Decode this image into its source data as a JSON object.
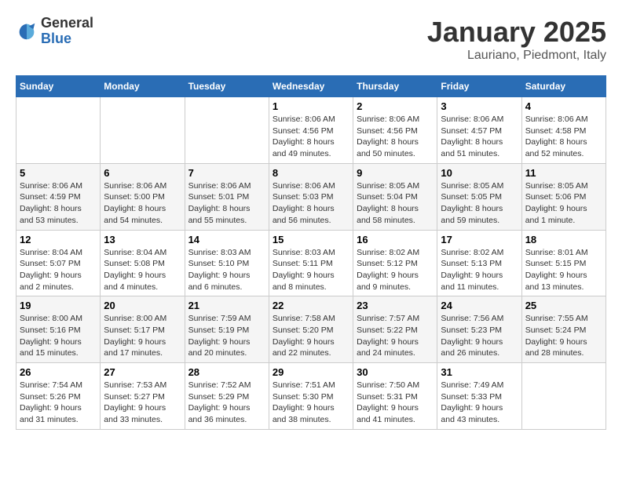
{
  "header": {
    "logo_general": "General",
    "logo_blue": "Blue",
    "month_title": "January 2025",
    "location": "Lauriano, Piedmont, Italy"
  },
  "weekdays": [
    "Sunday",
    "Monday",
    "Tuesday",
    "Wednesday",
    "Thursday",
    "Friday",
    "Saturday"
  ],
  "weeks": [
    [
      {
        "day": "",
        "info": ""
      },
      {
        "day": "",
        "info": ""
      },
      {
        "day": "",
        "info": ""
      },
      {
        "day": "1",
        "info": "Sunrise: 8:06 AM\nSunset: 4:56 PM\nDaylight: 8 hours and 49 minutes."
      },
      {
        "day": "2",
        "info": "Sunrise: 8:06 AM\nSunset: 4:56 PM\nDaylight: 8 hours and 50 minutes."
      },
      {
        "day": "3",
        "info": "Sunrise: 8:06 AM\nSunset: 4:57 PM\nDaylight: 8 hours and 51 minutes."
      },
      {
        "day": "4",
        "info": "Sunrise: 8:06 AM\nSunset: 4:58 PM\nDaylight: 8 hours and 52 minutes."
      }
    ],
    [
      {
        "day": "5",
        "info": "Sunrise: 8:06 AM\nSunset: 4:59 PM\nDaylight: 8 hours and 53 minutes."
      },
      {
        "day": "6",
        "info": "Sunrise: 8:06 AM\nSunset: 5:00 PM\nDaylight: 8 hours and 54 minutes."
      },
      {
        "day": "7",
        "info": "Sunrise: 8:06 AM\nSunset: 5:01 PM\nDaylight: 8 hours and 55 minutes."
      },
      {
        "day": "8",
        "info": "Sunrise: 8:06 AM\nSunset: 5:03 PM\nDaylight: 8 hours and 56 minutes."
      },
      {
        "day": "9",
        "info": "Sunrise: 8:05 AM\nSunset: 5:04 PM\nDaylight: 8 hours and 58 minutes."
      },
      {
        "day": "10",
        "info": "Sunrise: 8:05 AM\nSunset: 5:05 PM\nDaylight: 8 hours and 59 minutes."
      },
      {
        "day": "11",
        "info": "Sunrise: 8:05 AM\nSunset: 5:06 PM\nDaylight: 9 hours and 1 minute."
      }
    ],
    [
      {
        "day": "12",
        "info": "Sunrise: 8:04 AM\nSunset: 5:07 PM\nDaylight: 9 hours and 2 minutes."
      },
      {
        "day": "13",
        "info": "Sunrise: 8:04 AM\nSunset: 5:08 PM\nDaylight: 9 hours and 4 minutes."
      },
      {
        "day": "14",
        "info": "Sunrise: 8:03 AM\nSunset: 5:10 PM\nDaylight: 9 hours and 6 minutes."
      },
      {
        "day": "15",
        "info": "Sunrise: 8:03 AM\nSunset: 5:11 PM\nDaylight: 9 hours and 8 minutes."
      },
      {
        "day": "16",
        "info": "Sunrise: 8:02 AM\nSunset: 5:12 PM\nDaylight: 9 hours and 9 minutes."
      },
      {
        "day": "17",
        "info": "Sunrise: 8:02 AM\nSunset: 5:13 PM\nDaylight: 9 hours and 11 minutes."
      },
      {
        "day": "18",
        "info": "Sunrise: 8:01 AM\nSunset: 5:15 PM\nDaylight: 9 hours and 13 minutes."
      }
    ],
    [
      {
        "day": "19",
        "info": "Sunrise: 8:00 AM\nSunset: 5:16 PM\nDaylight: 9 hours and 15 minutes."
      },
      {
        "day": "20",
        "info": "Sunrise: 8:00 AM\nSunset: 5:17 PM\nDaylight: 9 hours and 17 minutes."
      },
      {
        "day": "21",
        "info": "Sunrise: 7:59 AM\nSunset: 5:19 PM\nDaylight: 9 hours and 20 minutes."
      },
      {
        "day": "22",
        "info": "Sunrise: 7:58 AM\nSunset: 5:20 PM\nDaylight: 9 hours and 22 minutes."
      },
      {
        "day": "23",
        "info": "Sunrise: 7:57 AM\nSunset: 5:22 PM\nDaylight: 9 hours and 24 minutes."
      },
      {
        "day": "24",
        "info": "Sunrise: 7:56 AM\nSunset: 5:23 PM\nDaylight: 9 hours and 26 minutes."
      },
      {
        "day": "25",
        "info": "Sunrise: 7:55 AM\nSunset: 5:24 PM\nDaylight: 9 hours and 28 minutes."
      }
    ],
    [
      {
        "day": "26",
        "info": "Sunrise: 7:54 AM\nSunset: 5:26 PM\nDaylight: 9 hours and 31 minutes."
      },
      {
        "day": "27",
        "info": "Sunrise: 7:53 AM\nSunset: 5:27 PM\nDaylight: 9 hours and 33 minutes."
      },
      {
        "day": "28",
        "info": "Sunrise: 7:52 AM\nSunset: 5:29 PM\nDaylight: 9 hours and 36 minutes."
      },
      {
        "day": "29",
        "info": "Sunrise: 7:51 AM\nSunset: 5:30 PM\nDaylight: 9 hours and 38 minutes."
      },
      {
        "day": "30",
        "info": "Sunrise: 7:50 AM\nSunset: 5:31 PM\nDaylight: 9 hours and 41 minutes."
      },
      {
        "day": "31",
        "info": "Sunrise: 7:49 AM\nSunset: 5:33 PM\nDaylight: 9 hours and 43 minutes."
      },
      {
        "day": "",
        "info": ""
      }
    ]
  ]
}
